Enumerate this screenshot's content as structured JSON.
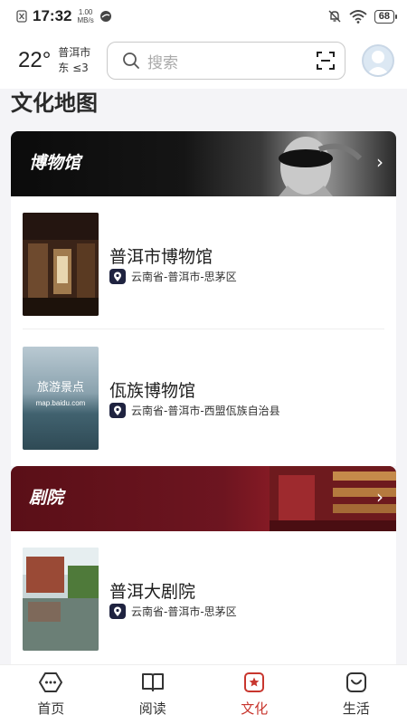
{
  "status_bar": {
    "time": "17:32",
    "speed_value": "1.00",
    "speed_unit": "MB/s",
    "battery": "68"
  },
  "header": {
    "temperature": "22°",
    "city": "普洱市",
    "wind": "东  ≤3",
    "search_placeholder": "搜索"
  },
  "page": {
    "title": "文化地图"
  },
  "sections": {
    "museums": {
      "label": "博物馆",
      "items": [
        {
          "name": "普洱市博物馆",
          "location": "云南省-普洱市-思茅区"
        },
        {
          "name": "佤族博物馆",
          "location": "云南省-普洱市-西盟佤族自治县",
          "thumb_text": "旅游景点",
          "thumb_subtext": "map.baidu.com"
        }
      ]
    },
    "theatres": {
      "label": "剧院",
      "items": [
        {
          "name": "普洱大剧院",
          "location": "云南省-普洱市-思茅区"
        }
      ]
    }
  },
  "tabs": [
    {
      "label": "首页",
      "icon": "home-icon"
    },
    {
      "label": "阅读",
      "icon": "book-icon"
    },
    {
      "label": "文化",
      "icon": "culture-icon",
      "active": true
    },
    {
      "label": "生活",
      "icon": "life-icon"
    }
  ],
  "colors": {
    "accent": "#c8362e",
    "theatre_banner": "#6d1520",
    "museum_banner": "#0b0b0b"
  }
}
